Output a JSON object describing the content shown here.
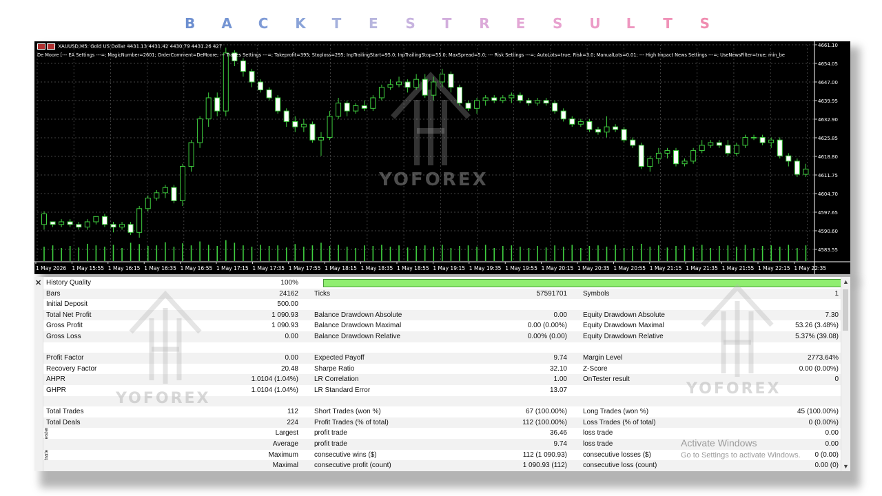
{
  "title_letters": [
    {
      "ch": "B",
      "color": "#6d8fd0"
    },
    {
      "ch": "A",
      "color": "#7595d3"
    },
    {
      "ch": "C",
      "color": "#7f9bd6"
    },
    {
      "ch": "K",
      "color": "#8aa3d8"
    },
    {
      "ch": "T",
      "color": "#a4b0dc"
    },
    {
      "ch": "E",
      "color": "#b8b6de"
    },
    {
      "ch": "S",
      "color": "#c7b3df"
    },
    {
      "ch": "T",
      "color": "#d2aedd"
    },
    {
      "ch": "R",
      "color": "#dcaad9"
    },
    {
      "ch": "E",
      "color": "#e3a7d5"
    },
    {
      "ch": "S",
      "color": "#e8a2cf"
    },
    {
      "ch": "U",
      "color": "#ec9cc7"
    },
    {
      "ch": "L",
      "color": "#ee97c0"
    },
    {
      "ch": "T",
      "color": "#f092b8"
    },
    {
      "ch": "S",
      "color": "#f08cb0"
    }
  ],
  "chart": {
    "symbol_line": "XAUUSD,M5:  Gold US Dollar  4431.13 4431.42 4430.79 4431.26  427",
    "params_line": "De Moore [--- EA Settings ---=; MagicNumber=2601; OrderComment=DeMoore; --- Trades Settings ---=; Takeprofit=395; Stoploss=295; InpTrailingStart=95.0; InpTrailingStop=55.0; MaxSpread=5.0; --- Risk Settings ---=; AutoLots=true; Risk=3.0; ManualLots=0.01; --- High Impact News Settings ---=; UseNewsFilter=true; min_be",
    "watermark": "YOFOREX",
    "price_labels": [
      "4661.10",
      "4654.05",
      "4647.00",
      "4639.95",
      "4632.90",
      "4625.85",
      "4618.80",
      "4611.75",
      "4604.70",
      "4597.65",
      "4590.60",
      "4583.55"
    ],
    "time_labels": [
      "1 May 2026",
      "1 May 15:55",
      "1 May 16:15",
      "1 May 16:35",
      "1 May 16:55",
      "1 May 17:15",
      "1 May 17:35",
      "1 May 17:55",
      "1 May 18:15",
      "1 May 18:35",
      "1 May 18:55",
      "1 May 19:15",
      "1 May 19:35",
      "1 May 19:55",
      "1 May 20:15",
      "1 May 20:35",
      "1 May 20:55",
      "1 May 21:15",
      "1 May 21:35",
      "1 May 21:55",
      "1 May 22:15",
      "1 May 22:35"
    ],
    "price_max": 4661.1,
    "price_min": 4583.55,
    "candles": [
      [
        4593,
        4598,
        4591,
        4597
      ],
      [
        4594,
        4594,
        4592,
        4593
      ],
      [
        4593,
        4595,
        4592,
        4594
      ],
      [
        4594,
        4595,
        4592,
        4593
      ],
      [
        4593,
        4594,
        4591,
        4592
      ],
      [
        4592,
        4595,
        4591,
        4594
      ],
      [
        4594,
        4596,
        4593,
        4596
      ],
      [
        4596,
        4597,
        4592,
        4593
      ],
      [
        4593,
        4594,
        4590,
        4592
      ],
      [
        4592,
        4594,
        4591,
        4593
      ],
      [
        4593,
        4594,
        4589,
        4590
      ],
      [
        4590,
        4600,
        4588,
        4599
      ],
      [
        4599,
        4604,
        4598,
        4603
      ],
      [
        4603,
        4606,
        4602,
        4605
      ],
      [
        4605,
        4608,
        4603,
        4607
      ],
      [
        4607,
        4608,
        4601,
        4602
      ],
      [
        4602,
        4616,
        4600,
        4615
      ],
      [
        4615,
        4625,
        4613,
        4624
      ],
      [
        4624,
        4634,
        4622,
        4633
      ],
      [
        4633,
        4643,
        4630,
        4641
      ],
      [
        4641,
        4643,
        4634,
        4636
      ],
      [
        4636,
        4660,
        4634,
        4658
      ],
      [
        4658,
        4659,
        4653,
        4655
      ],
      [
        4655,
        4656,
        4649,
        4651
      ],
      [
        4651,
        4652,
        4645,
        4647
      ],
      [
        4647,
        4648,
        4643,
        4644
      ],
      [
        4644,
        4645,
        4640,
        4641
      ],
      [
        4641,
        4642,
        4635,
        4636
      ],
      [
        4636,
        4637,
        4630,
        4632
      ],
      [
        4632,
        4634,
        4628,
        4630
      ],
      [
        4630,
        4633,
        4628,
        4631
      ],
      [
        4631,
        4632,
        4624,
        4625
      ],
      [
        4625,
        4628,
        4619,
        4626
      ],
      [
        4626,
        4636,
        4625,
        4634
      ],
      [
        4634,
        4641,
        4633,
        4639
      ],
      [
        4639,
        4640,
        4634,
        4636
      ],
      [
        4636,
        4639,
        4635,
        4638
      ],
      [
        4638,
        4640,
        4636,
        4637
      ],
      [
        4637,
        4642,
        4636,
        4641
      ],
      [
        4641,
        4646,
        4640,
        4645
      ],
      [
        4645,
        4648,
        4644,
        4646
      ],
      [
        4646,
        4649,
        4645,
        4647
      ],
      [
        4647,
        4648,
        4643,
        4645
      ],
      [
        4645,
        4650,
        4644,
        4648
      ],
      [
        4648,
        4650,
        4641,
        4642
      ],
      [
        4642,
        4649,
        4640,
        4647
      ],
      [
        4647,
        4652,
        4645,
        4650
      ],
      [
        4650,
        4651,
        4643,
        4645
      ],
      [
        4645,
        4646,
        4638,
        4639
      ],
      [
        4639,
        4640,
        4636,
        4637
      ],
      [
        4637,
        4641,
        4635,
        4640
      ],
      [
        4640,
        4642,
        4638,
        4641
      ],
      [
        4641,
        4642,
        4639,
        4640
      ],
      [
        4640,
        4642,
        4639,
        4641
      ],
      [
        4641,
        4643,
        4639,
        4642
      ],
      [
        4642,
        4643,
        4639,
        4640
      ],
      [
        4640,
        4641,
        4638,
        4639
      ],
      [
        4639,
        4641,
        4638,
        4640
      ],
      [
        4640,
        4641,
        4638,
        4639
      ],
      [
        4639,
        4640,
        4635,
        4636
      ],
      [
        4636,
        4637,
        4632,
        4633
      ],
      [
        4633,
        4634,
        4630,
        4631
      ],
      [
        4631,
        4633,
        4630,
        4632
      ],
      [
        4632,
        4633,
        4628,
        4629
      ],
      [
        4629,
        4630,
        4627,
        4628
      ],
      [
        4628,
        4634,
        4626,
        4630
      ],
      [
        4630,
        4631,
        4628,
        4629
      ],
      [
        4629,
        4630,
        4624,
        4625
      ],
      [
        4625,
        4626,
        4622,
        4623
      ],
      [
        4623,
        4624,
        4614,
        4615
      ],
      [
        4615,
        4619,
        4613,
        4618
      ],
      [
        4618,
        4622,
        4616,
        4620
      ],
      [
        4620,
        4622,
        4618,
        4621
      ],
      [
        4621,
        4622,
        4615,
        4616
      ],
      [
        4616,
        4618,
        4615,
        4617
      ],
      [
        4617,
        4622,
        4616,
        4621
      ],
      [
        4621,
        4625,
        4620,
        4623
      ],
      [
        4623,
        4625,
        4622,
        4624
      ],
      [
        4624,
        4625,
        4622,
        4623
      ],
      [
        4623,
        4625,
        4619,
        4620
      ],
      [
        4620,
        4624,
        4619,
        4623
      ],
      [
        4623,
        4627,
        4622,
        4626
      ],
      [
        4626,
        4627,
        4625,
        4626
      ],
      [
        4626,
        4627,
        4623,
        4624
      ],
      [
        4624,
        4626,
        4622,
        4625
      ],
      [
        4625,
        4626,
        4618,
        4619
      ],
      [
        4619,
        4620,
        4615,
        4617
      ],
      [
        4617,
        4618,
        4611,
        4612
      ],
      [
        4612,
        4616,
        4611,
        4614
      ]
    ],
    "volumes": [
      0.55,
      0.6,
      0.5,
      0.58,
      0.52,
      0.66,
      0.6,
      0.55,
      0.62,
      0.5,
      0.7,
      0.65,
      0.58,
      0.6,
      0.72,
      0.55,
      0.68,
      0.6,
      0.75,
      0.62,
      0.58,
      0.8,
      0.7,
      0.6,
      0.55,
      0.62,
      0.58,
      0.6,
      0.52,
      0.65,
      0.55,
      0.6,
      0.7,
      0.58,
      0.62,
      0.55,
      0.5,
      0.6,
      0.58,
      0.62,
      0.55,
      0.6,
      0.52,
      0.58,
      0.6,
      0.55,
      0.62,
      0.5,
      0.58,
      0.6,
      0.55,
      0.62,
      0.5,
      0.58,
      0.6,
      0.55,
      0.5,
      0.58,
      0.52,
      0.6,
      0.55,
      0.62,
      0.5,
      0.58,
      0.6,
      0.55,
      0.62,
      0.5,
      0.58,
      0.66,
      0.55,
      0.6,
      0.52,
      0.58,
      0.6,
      0.55,
      0.62,
      0.5,
      0.58,
      0.6,
      0.55,
      0.62,
      0.5,
      0.58,
      0.6,
      0.55,
      0.62,
      0.5,
      0.6
    ]
  },
  "report": {
    "side_label": "Strategy Tester",
    "watermark": "YOFOREX",
    "activate_title": "Activate Windows",
    "activate_sub": "Go to Settings to activate Windows.",
    "rows": [
      {
        "l": "History Quality",
        "lv": "100%",
        "bar": true
      },
      {
        "l": "Bars",
        "lv": "24162",
        "m": "Ticks",
        "mv": "57591701",
        "r": "Symbols",
        "rv": "1"
      },
      {
        "l": "Initial Deposit",
        "lv": "500.00"
      },
      {
        "l": "Total Net Profit",
        "lv": "1 090.93",
        "m": "Balance Drawdown Absolute",
        "mv": "0.00",
        "r": "Equity Drawdown Absolute",
        "rv": "7.30"
      },
      {
        "l": "Gross Profit",
        "lv": "1 090.93",
        "m": "Balance Drawdown Maximal",
        "mv": "0.00 (0.00%)",
        "r": "Equity Drawdown Maximal",
        "rv": "53.26 (3.48%)"
      },
      {
        "l": "Gross Loss",
        "lv": "0.00",
        "m": "Balance Drawdown Relative",
        "mv": "0.00% (0.00)",
        "r": "Equity Drawdown Relative",
        "rv": "5.37% (39.08)"
      },
      {},
      {
        "l": "Profit Factor",
        "lv": "0.00",
        "m": "Expected Payoff",
        "mv": "9.74",
        "r": "Margin Level",
        "rv": "2773.64%"
      },
      {
        "l": "Recovery Factor",
        "lv": "20.48",
        "m": "Sharpe Ratio",
        "mv": "32.10",
        "r": "Z-Score",
        "rv": "0.00 (0.00%)"
      },
      {
        "l": "AHPR",
        "lv": "1.0104 (1.04%)",
        "m": "LR Correlation",
        "mv": "1.00",
        "r": "OnTester result",
        "rv": "0"
      },
      {
        "l": "GHPR",
        "lv": "1.0104 (1.04%)",
        "m": "LR Standard Error",
        "mv": "13.07"
      },
      {},
      {
        "l": "Total Trades",
        "lv": "112",
        "m": "Short Trades (won %)",
        "mv": "67 (100.00%)",
        "r": "Long Trades (won %)",
        "rv": "45 (100.00%)"
      },
      {
        "l": "Total Deals",
        "lv": "224",
        "m": "Profit Trades (% of total)",
        "mv": "112 (100.00%)",
        "r": "Loss Trades (% of total)",
        "rv": "0 (0.00%)"
      },
      {
        "lv": "Largest",
        "m": "profit trade",
        "mv": "36.46",
        "r": "loss trade",
        "rv": "0.00"
      },
      {
        "lv": "Average",
        "m": "profit trade",
        "mv": "9.74",
        "r": "loss trade",
        "rv": "0.00"
      },
      {
        "lv": "Maximum",
        "m": "consecutive wins ($)",
        "mv": "112 (1 090.93)",
        "r": "consecutive losses ($)",
        "rv": "0 (0.00)"
      },
      {
        "lv": "Maximal",
        "m": "consecutive profit (count)",
        "mv": "1 090.93 (112)",
        "r": "consecutive loss (count)",
        "rv": "0.00 (0)"
      }
    ]
  }
}
